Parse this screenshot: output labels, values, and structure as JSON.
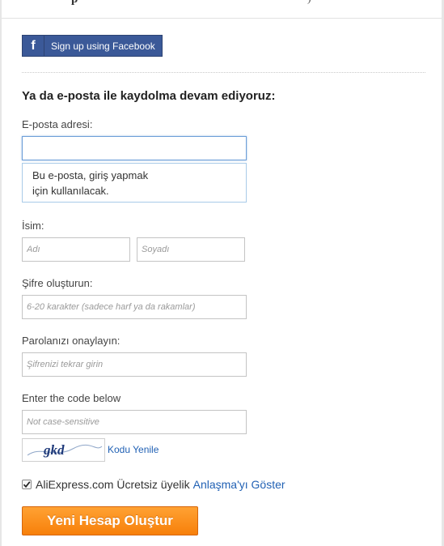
{
  "facebook": {
    "label": "Sign up using Facebook",
    "icon": "f",
    "color": "#3b5998"
  },
  "form": {
    "title": "Ya da e-posta ile kaydolma devam ediyoruz:",
    "email": {
      "label": "E-posta adresi:",
      "value": "",
      "hint_line1": "Bu e-posta, giriş yapmak",
      "hint_line2": "için kullanılacak."
    },
    "name": {
      "label": "İsim:",
      "first_placeholder": "Adı",
      "last_placeholder": "Soyadı"
    },
    "password": {
      "label": "Şifre oluşturun:",
      "placeholder": "6-20 karakter (sadece harf ya da rakamlar)"
    },
    "confirm": {
      "label": "Parolanızı onaylayın:",
      "placeholder": "Şifrenizi tekrar girin"
    },
    "code": {
      "label": "Enter the code below",
      "placeholder": "Not case-sensitive",
      "captcha_text": "gkd",
      "refresh_label": "Kodu Yenile"
    },
    "agreement": {
      "checked": true,
      "text": "AliExpress.com Ücretsiz üyelik",
      "link_text": "Anlaşma'yı Göster"
    },
    "submit_label": "Yeni Hesap Oluştur",
    "submit_color": "#f7800a",
    "link_color": "#2161b4"
  }
}
